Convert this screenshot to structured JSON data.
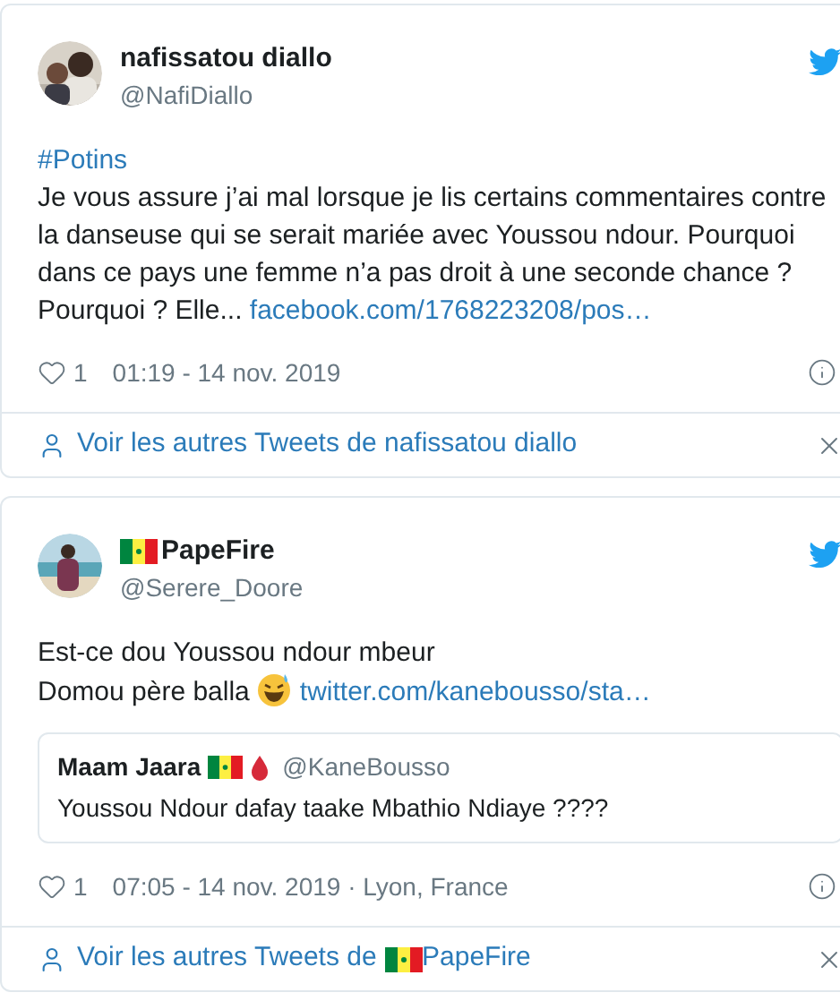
{
  "tweets": [
    {
      "author": {
        "name": "nafissatou diallo",
        "handle": "@NafiDiallo"
      },
      "body": [
        {
          "kind": "hashtag",
          "text": "#Potins"
        },
        {
          "kind": "paragraph",
          "text": "Je vous assure j’ai mal lorsque je lis certains commentaires contre la danseuse qui se serait mariée avec Youssou ndour. Pourquoi dans ce pays une femme n’a pas droit à une seconde chance ? Pourquoi ? Elle...",
          "link": "facebook.com/1768223208/pos…"
        }
      ],
      "likes": "1",
      "timestamp": "01:19 - 14 nov. 2019",
      "more": {
        "prefix": "Voir les autres Tweets de",
        "name": "nafissatou diallo"
      }
    },
    {
      "author": {
        "name": "PapeFire",
        "handle": "@Serere_Doore",
        "flag": true
      },
      "body": [
        {
          "kind": "paragraph",
          "text": "Est-ce dou Youssou ndour mbeur"
        },
        {
          "kind": "paragraph",
          "text": "Domou père balla",
          "link": "twitter.com/kanebousso/sta…",
          "emoji": true
        }
      ],
      "quote": {
        "name": "Maam Jaara",
        "flag": true,
        "drop": true,
        "handle": "@KaneBousso",
        "text": "Youssou Ndour dafay taake Mbathio Ndiaye ????"
      },
      "likes": "1",
      "timestamp": "07:05 - 14 nov. 2019 · Lyon, France",
      "more": {
        "prefix": "Voir les autres Tweets de",
        "name": "PapeFire",
        "flag": true
      }
    }
  ]
}
